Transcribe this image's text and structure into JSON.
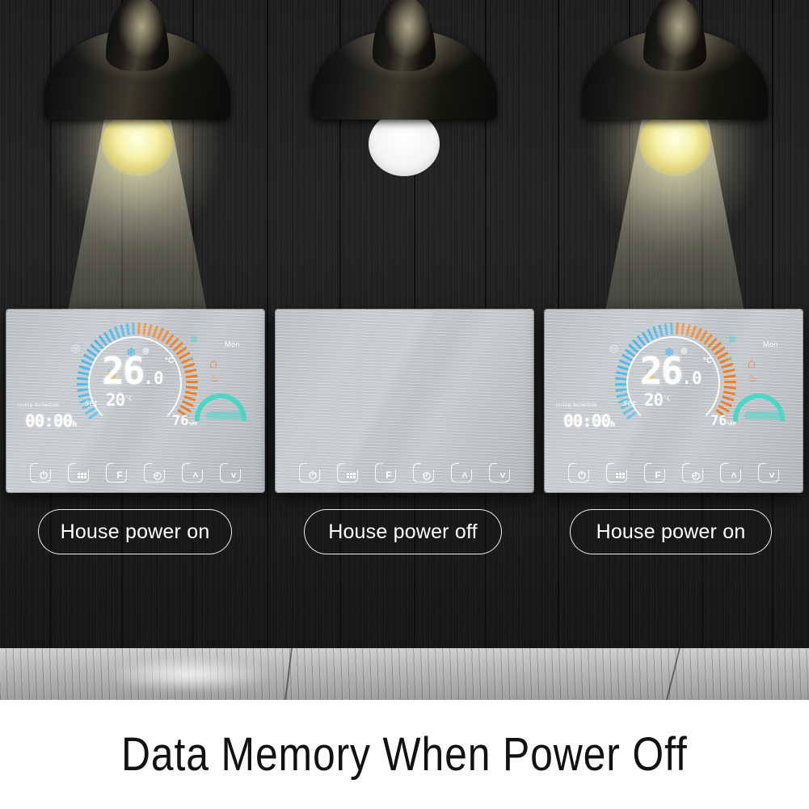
{
  "caption": {
    "text": "Data Memory When Power Off"
  },
  "scene": {
    "lamps": [
      {
        "name": "lamp-left",
        "state": "on",
        "bulb_color": "#f7f0a8",
        "glow": "warm-yellow"
      },
      {
        "name": "lamp-center",
        "state": "off",
        "bulb_color": "#ffffff",
        "glow": "none"
      },
      {
        "name": "lamp-right",
        "state": "on",
        "bulb_color": "#f7f0a8",
        "glow": "warm-yellow"
      }
    ],
    "wall_color": "#1f1f1f",
    "floor_color": "#b9b9b9"
  },
  "labels": [
    {
      "text": "House power on"
    },
    {
      "text": "House power off"
    },
    {
      "text": "House power on"
    }
  ],
  "thermostats": [
    {
      "id": "thermostat-left",
      "state": "on",
      "display": {
        "current_temp": "26",
        "current_temp_decimal": ".0",
        "temp_unit": "°C",
        "set_label": "Set",
        "set_temp": "20",
        "set_unit": "°C",
        "mode_text": "Using Schedule",
        "clock": "00:00",
        "clock_unit": "h",
        "humidity": "76",
        "humidity_unit": "%RH",
        "day": "Mon",
        "icons": [
          "wifi-icon",
          "snowflake-icon",
          "snowflake-outline-icon",
          "lock-icon",
          "fan-icon",
          "eco-leaf-icon",
          "house-icon",
          "flame-icon",
          "humidity-cloud-icon"
        ],
        "dial": {
          "cool_color": "#4cb8e8",
          "heat_color": "#ef7f22",
          "cool_ticks": 22,
          "heat_ticks": 22
        }
      },
      "buttons": [
        {
          "name": "power-button",
          "glyph": "⏻",
          "label": "power"
        },
        {
          "name": "menu-button",
          "glyph": "grid",
          "label": "menu"
        },
        {
          "name": "function-button",
          "glyph": "F",
          "label": "F"
        },
        {
          "name": "timer-button",
          "glyph": "◴",
          "label": "clock"
        },
        {
          "name": "up-button",
          "glyph": "˄",
          "label": "up"
        },
        {
          "name": "down-button",
          "glyph": "˅",
          "label": "down"
        }
      ]
    },
    {
      "id": "thermostat-center",
      "state": "off",
      "display": {
        "current_temp": "",
        "current_temp_decimal": "",
        "temp_unit": "",
        "set_label": "",
        "set_temp": "",
        "set_unit": "",
        "mode_text": "",
        "clock": "",
        "clock_unit": "",
        "humidity": "",
        "humidity_unit": "",
        "day": "",
        "icons": [],
        "dial": {
          "cool_color": "",
          "heat_color": "",
          "cool_ticks": 0,
          "heat_ticks": 0
        }
      },
      "buttons": [
        {
          "name": "power-button",
          "glyph": "⏻",
          "label": "power"
        },
        {
          "name": "menu-button",
          "glyph": "grid",
          "label": "menu"
        },
        {
          "name": "function-button",
          "glyph": "F",
          "label": "F"
        },
        {
          "name": "timer-button",
          "glyph": "◴",
          "label": "clock"
        },
        {
          "name": "up-button",
          "glyph": "˄",
          "label": "up"
        },
        {
          "name": "down-button",
          "glyph": "˅",
          "label": "down"
        }
      ]
    },
    {
      "id": "thermostat-right",
      "state": "on",
      "display": {
        "current_temp": "26",
        "current_temp_decimal": ".0",
        "temp_unit": "°C",
        "set_label": "Set",
        "set_temp": "20",
        "set_unit": "°C",
        "mode_text": "Using Schedule",
        "clock": "00:00",
        "clock_unit": "h",
        "humidity": "76",
        "humidity_unit": "%RH",
        "day": "Mon",
        "icons": [
          "wifi-icon",
          "snowflake-icon",
          "snowflake-outline-icon",
          "lock-icon",
          "fan-icon",
          "eco-leaf-icon",
          "house-icon",
          "flame-icon",
          "humidity-cloud-icon"
        ],
        "dial": {
          "cool_color": "#4cb8e8",
          "heat_color": "#ef7f22",
          "cool_ticks": 22,
          "heat_ticks": 22
        }
      },
      "buttons": [
        {
          "name": "power-button",
          "glyph": "⏻",
          "label": "power"
        },
        {
          "name": "menu-button",
          "glyph": "grid",
          "label": "menu"
        },
        {
          "name": "function-button",
          "glyph": "F",
          "label": "F"
        },
        {
          "name": "timer-button",
          "glyph": "◴",
          "label": "clock"
        },
        {
          "name": "up-button",
          "glyph": "˄",
          "label": "up"
        },
        {
          "name": "down-button",
          "glyph": "˅",
          "label": "down"
        }
      ]
    }
  ]
}
